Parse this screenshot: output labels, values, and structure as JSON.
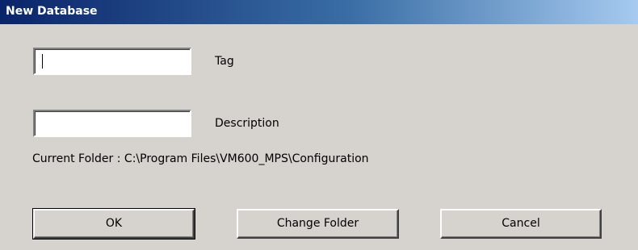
{
  "window": {
    "title": "New Database"
  },
  "form": {
    "tag": {
      "value": "",
      "label": "Tag"
    },
    "description": {
      "value": "",
      "label": "Description"
    },
    "current_folder": "Current Folder : C:\\Program Files\\VM600_MPS\\Configuration"
  },
  "buttons": {
    "ok": "OK",
    "change_folder": "Change Folder",
    "cancel": "Cancel"
  },
  "colors": {
    "dialog_background": "#d6d3ce",
    "titlebar_start": "#0a246a",
    "titlebar_end": "#a6caf0",
    "title_text": "#ffffff"
  }
}
